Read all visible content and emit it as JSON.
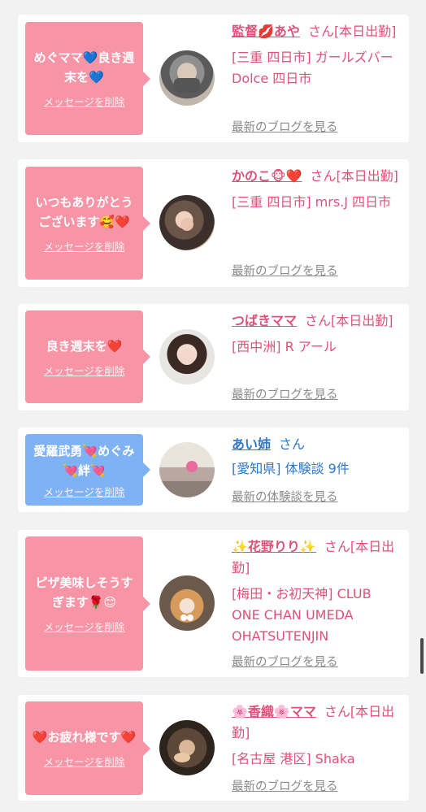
{
  "colors": {
    "page_bg": "#f2f2f2",
    "card_bg": "#ffffff",
    "pink_bubble": "#f795a6",
    "blue_bubble": "#7fb2f4",
    "pink_text": "#e0507a",
    "blue_text": "#2e77c9",
    "gray_link": "#8a8a8a"
  },
  "delete_label": "メッセージを削除",
  "posts": [
    {
      "message": "めぐママ💙良き週末を💙",
      "name": "監督💋あや",
      "suffix": "さん[本日出勤]",
      "location": "[三重 四日市] ガールズバー Dolce 四日市",
      "link": "最新のブログを見る",
      "bubble_color": "pink"
    },
    {
      "message": "いつもありがとうございます🥰❤️",
      "name": "かのこ🐵❤️",
      "suffix": "さん[本日出勤]",
      "location": "[三重 四日市] mrs.J 四日市",
      "link": "最新のブログを見る",
      "bubble_color": "pink"
    },
    {
      "message": "良き週末を❤️",
      "name": "つばきママ",
      "suffix": "さん[本日出勤]",
      "location": "[西中洲] R アール",
      "link": "最新のブログを見る",
      "bubble_color": "pink"
    },
    {
      "message": "愛羅武勇💘めぐみ💘絆💘",
      "name": "あい姉",
      "suffix": "さん",
      "location": "[愛知県] 体験談 9件",
      "link": "最新の体験談を見る",
      "bubble_color": "blue"
    },
    {
      "message": "ピザ美味しそうすぎます🌹😊",
      "name": "✨花野りり✨",
      "suffix": "さん[本日出勤]",
      "location": "[梅田・お初天神] CLUB ONE CHAN UMEDA OHATSUTENJIN",
      "link": "最新のブログを見る",
      "bubble_color": "pink"
    },
    {
      "message": "❤️お疲れ様です❤️",
      "name": "🌸香織🌸ママ",
      "suffix": "さん[本日出勤]",
      "location": "[名古屋 港区] Shaka",
      "link": "最新のブログを見る",
      "bubble_color": "pink"
    }
  ]
}
